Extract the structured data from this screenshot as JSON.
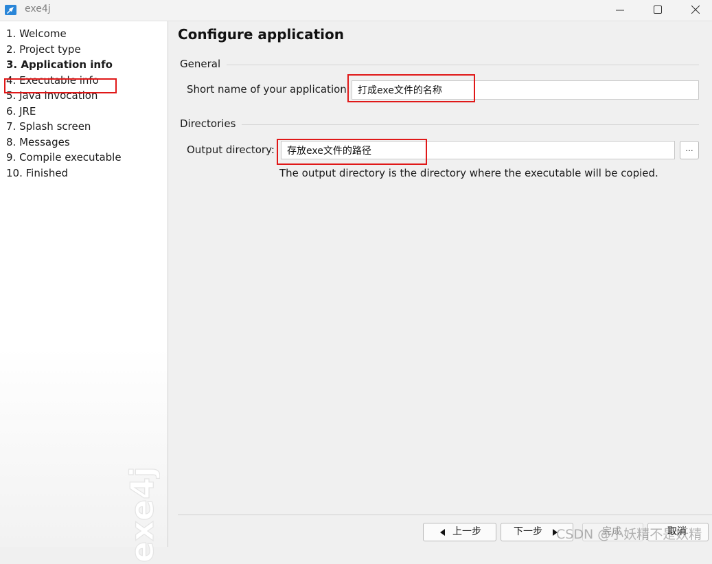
{
  "window": {
    "title": "exe4j"
  },
  "sidebar": {
    "steps": [
      "1. Welcome",
      "2. Project type",
      "3. Application info",
      "4. Executable info",
      "5. Java invocation",
      "6. JRE",
      "7. Splash screen",
      "8. Messages",
      "9. Compile executable",
      "10. Finished"
    ],
    "active_index": 2,
    "logo_text": "exe4j"
  },
  "main": {
    "title": "Configure application",
    "general": {
      "label": "General",
      "short_name_label": "Short name of your application:",
      "short_name_value": "打成exe文件的名称"
    },
    "directories": {
      "label": "Directories",
      "output_label": "Output directory:",
      "output_value": "存放exe文件的路径",
      "browse_label": "...",
      "help_text": "The output directory is the directory where the executable will be copied."
    }
  },
  "footer": {
    "back_label": "上一步",
    "next_label": "下一步",
    "finish_label": "完成",
    "cancel_label": "取消"
  },
  "watermark": "CSDN @小妖精不是妖精",
  "colors": {
    "highlight": "#e01818",
    "accent": "#2a86d8"
  }
}
